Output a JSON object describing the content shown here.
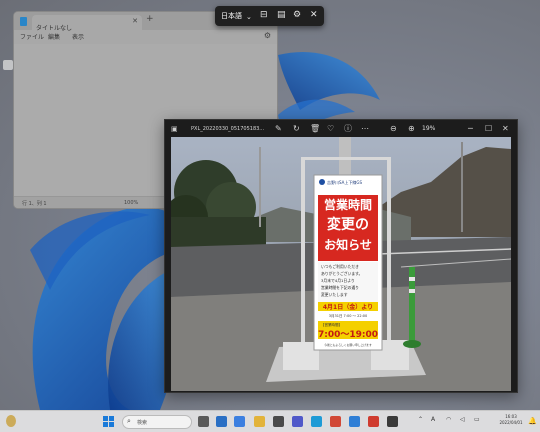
{
  "notepad": {
    "tab_title": "タイトルなし",
    "menu": [
      "ファイル",
      "編集",
      "表示"
    ],
    "status": {
      "position": "行 1、列 1",
      "zoom": "100%"
    },
    "icons": [
      "notepad-icon",
      "close-icon",
      "plus-icon",
      "gear-icon"
    ]
  },
  "viewer": {
    "filename": "PXL_20220330_051705183...",
    "zoom": "19%",
    "icons": [
      "image-file-icon",
      "edit-icon",
      "rotate-icon",
      "trash-icon",
      "heart-icon",
      "info-icon",
      "zoom-out-icon",
      "zoom-in-icon",
      "minimize-icon",
      "maximize-icon",
      "close-icon"
    ]
  },
  "photo": {
    "sign_header": "吉野川SA上下線GS",
    "sign_line1": "営業時間",
    "sign_line2": "変更の",
    "sign_line3": "お知らせ",
    "sign_body": [
      "いつもご利用いただき",
      "ありがとうございます。",
      "3月末で4月1日より",
      "営業時間を下記の通り",
      "変更いたします"
    ],
    "sign_date": "4月1日（金）より",
    "sign_date_sub": "3月31日  7:00 ～ 22:00",
    "sign_hours_label": "【営業時間】",
    "sign_hours": "7:00～19:00",
    "sign_footer": "今後ともよろしくお願い申し上げます"
  },
  "taskbar": {
    "search_placeholder": "検索",
    "clock_time": "16:03",
    "clock_date": "2022/04/01",
    "icons": [
      "start-icon",
      "search-icon",
      "task-view-icon",
      "widgets-icon",
      "file-explorer-icon",
      "store-icon",
      "teams-icon",
      "edge-icon",
      "chrome-icon",
      "photos-icon",
      "app-icon",
      "app-icon",
      "chevron-up-icon",
      "ime-icon",
      "wifi-icon",
      "volume-icon",
      "battery-icon",
      "bell-icon"
    ],
    "colors": {
      "start": "#1a7ad9",
      "accent": "#2f7fd6"
    }
  },
  "ime": {
    "language": "日本語",
    "icons": [
      "chevron-down-icon",
      "input-mode-icon",
      "dictionary-icon",
      "settings-icon",
      "close-icon"
    ]
  }
}
